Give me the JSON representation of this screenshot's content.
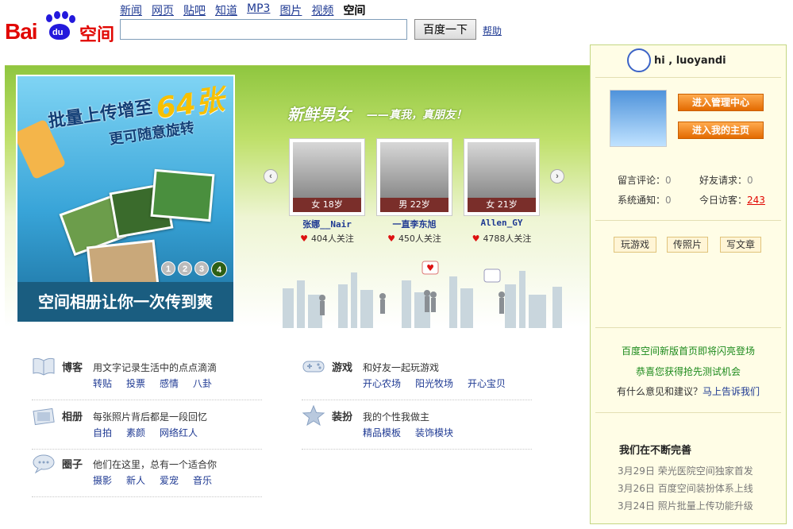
{
  "nav": {
    "links": [
      "新闻",
      "网页",
      "贴吧",
      "知道",
      "MP3",
      "图片",
      "视频"
    ],
    "current": "空间",
    "search_button": "百度一下",
    "help": "帮助"
  },
  "logo": {
    "bai": "Bai",
    "du": "du",
    "name": "空间"
  },
  "promo": {
    "line1": "批量上传增至",
    "num": "64张",
    "line2": "更可随意旋转",
    "caption": "空间相册让你一次传到爽",
    "pages": [
      "1",
      "2",
      "3",
      "4"
    ],
    "active_page": "4"
  },
  "fresh": {
    "title": "新鲜男女",
    "subtitle": "——真我，真朋友！",
    "users": [
      {
        "meta": "女 18岁",
        "name": "张娜__Nair",
        "follow": "404人关注"
      },
      {
        "meta": "男 22岁",
        "name": "一直李东旭",
        "follow": "450人关注"
      },
      {
        "meta": "女 21岁",
        "name": "Allen_GY",
        "follow": "4788人关注"
      }
    ]
  },
  "categories": [
    {
      "name": "博客",
      "desc": "用文字记录生活中的点点滴滴",
      "links": [
        "转贴",
        "投票",
        "感情",
        "八卦"
      ],
      "icon": "book-icon"
    },
    {
      "name": "相册",
      "desc": "每张照片背后都是一段回忆",
      "links": [
        "自拍",
        "素颜",
        "网络红人"
      ],
      "icon": "photo-icon"
    },
    {
      "name": "圈子",
      "desc": "他们在这里，总有一个适合你",
      "links": [
        "摄影",
        "新人",
        "爱宠",
        "音乐"
      ],
      "icon": "chat-bubble-icon"
    },
    {
      "name": "游戏",
      "desc": "和好友一起玩游戏",
      "links": [
        "开心农场",
        "阳光牧场",
        "开心宝贝"
      ],
      "icon": "gamepad-icon"
    },
    {
      "name": "装扮",
      "desc": "我的个性我做主",
      "links": [
        "精品模板",
        "装饰模块"
      ],
      "icon": "star-icon"
    }
  ],
  "sidebar": {
    "greeting": "hi , luoyandi",
    "btn_admin": "进入管理中心",
    "btn_home": "进入我的主页",
    "stats": [
      {
        "label": "留言评论：",
        "value": "0"
      },
      {
        "label": "好友请求：",
        "value": "0"
      },
      {
        "label": "系统通知：",
        "value": "0"
      },
      {
        "label": "今日访客：",
        "value": "243"
      }
    ],
    "actions": [
      "玩游戏",
      "传照片",
      "写文章"
    ],
    "news1": "百度空间新版首页即将闪亮登场",
    "news2": "恭喜您获得抢先测试机会",
    "feedback_q": "有什么意见和建议？",
    "feedback_link": "马上告诉我们",
    "improve_title": "我们在不断完善",
    "improvements": [
      "3月29日 荣光医院空间独家首发",
      "3月26日 百度空间装扮体系上线",
      "3月24日 照片批量上传功能升级"
    ]
  },
  "colors": {
    "brand_red": "#e10601",
    "brand_blue": "#2319dc",
    "link": "#1f3a93",
    "orange": "#ff8a00",
    "green": "#8fc63f"
  }
}
